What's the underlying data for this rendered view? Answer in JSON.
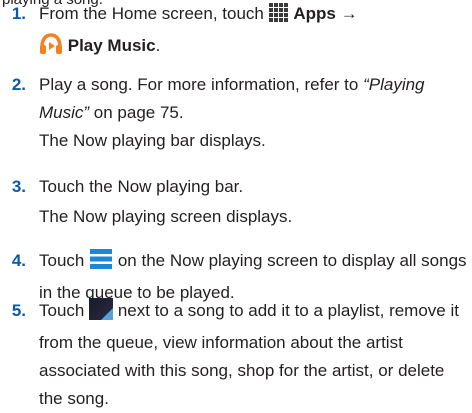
{
  "top_fragment": "playing a song.",
  "steps": [
    {
      "number": "1.",
      "text_a": "From the Home screen, touch",
      "apps_label": "Apps",
      "arrow": "→",
      "play_music_label": "Play Music",
      "suffix": ".",
      "icons": [
        "apps-grid-icon",
        "play-music-headphones-icon"
      ]
    },
    {
      "number": "2.",
      "text_a": "Play a song. For more information, refer to",
      "ref_title": "“Playing Music”",
      "text_b": "on page 75.",
      "sub": "The Now playing bar displays."
    },
    {
      "number": "3.",
      "text_a": "Touch the Now playing bar.",
      "sub": "The Now playing screen displays."
    },
    {
      "number": "4.",
      "text_a": "Touch",
      "text_b": "on the Now playing screen to display all songs in the queue to be played.",
      "icons": [
        "queue-list-icon"
      ]
    },
    {
      "number": "5.",
      "text_a": "Touch",
      "text_b": "next to a song to add it to a playlist, remove it from the queue, view information about the artist associated with this song, shop for the artist, or delete the song.",
      "icons": [
        "context-menu-icon"
      ]
    }
  ],
  "colors": {
    "number": "#0a5aa8",
    "text": "#231f20",
    "queue_icon": "#1e87d5",
    "play_music_orange": "#f5821f"
  }
}
